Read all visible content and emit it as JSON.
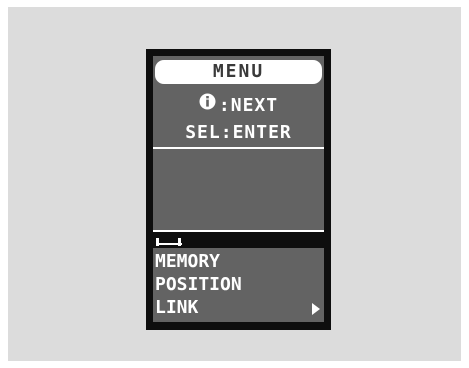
{
  "screen": {
    "title": "MENU",
    "info_line": ":NEXT",
    "sel_line": "SEL:ENTER"
  },
  "menu": {
    "items": [
      {
        "label": "MEMORY"
      },
      {
        "label": "POSITION"
      },
      {
        "label": "LINK"
      }
    ]
  },
  "icons": {
    "info": "info-icon",
    "more": "arrow-right-icon",
    "tab": "tab-marker-icon"
  },
  "colors": {
    "display_bg": "#636363",
    "bezel": "#0e0e0e",
    "backdrop": "#dcdcdc",
    "text": "#ffffff",
    "title_text": "#3a3a3a"
  }
}
